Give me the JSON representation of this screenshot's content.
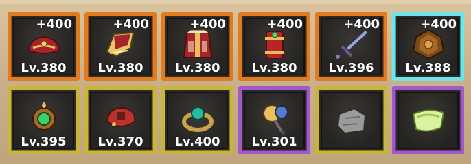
{
  "items": [
    {
      "rarity": "orange",
      "bonus": "+400",
      "level": "Lv.380",
      "icon": "hat-icon"
    },
    {
      "rarity": "orange",
      "bonus": "+400",
      "level": "Lv.380",
      "icon": "shoulder-armor-icon"
    },
    {
      "rarity": "orange",
      "bonus": "+400",
      "level": "Lv.380",
      "icon": "chest-armor-icon"
    },
    {
      "rarity": "orange",
      "bonus": "+400",
      "level": "Lv.380",
      "icon": "bracer-icon"
    },
    {
      "rarity": "orange",
      "bonus": "+400",
      "level": "Lv.396",
      "icon": "sword-icon"
    },
    {
      "rarity": "cyan",
      "bonus": "+400",
      "level": "Lv.388",
      "icon": "ornate-crest-icon"
    },
    {
      "rarity": "yellow",
      "bonus": "",
      "level": "Lv.395",
      "icon": "gem-amulet-icon"
    },
    {
      "rarity": "yellow",
      "bonus": "",
      "level": "Lv.370",
      "icon": "gauntlet-icon"
    },
    {
      "rarity": "yellow",
      "bonus": "",
      "level": "Lv.400",
      "icon": "gem-ring-icon"
    },
    {
      "rarity": "purple",
      "bonus": "",
      "level": "Lv.301",
      "icon": "key-bundle-icon"
    },
    {
      "rarity": "none",
      "bonus": "",
      "level": "",
      "icon": "stone-icon"
    },
    {
      "rarity": "purple",
      "bonus": "",
      "level": "",
      "icon": "scroll-horn-icon"
    }
  ],
  "colors": {
    "orange": "#e27a1e",
    "cyan": "#6fe5ea",
    "yellow": "#c8b53a",
    "purple": "#a05bc9",
    "none": "#c8b53a"
  }
}
